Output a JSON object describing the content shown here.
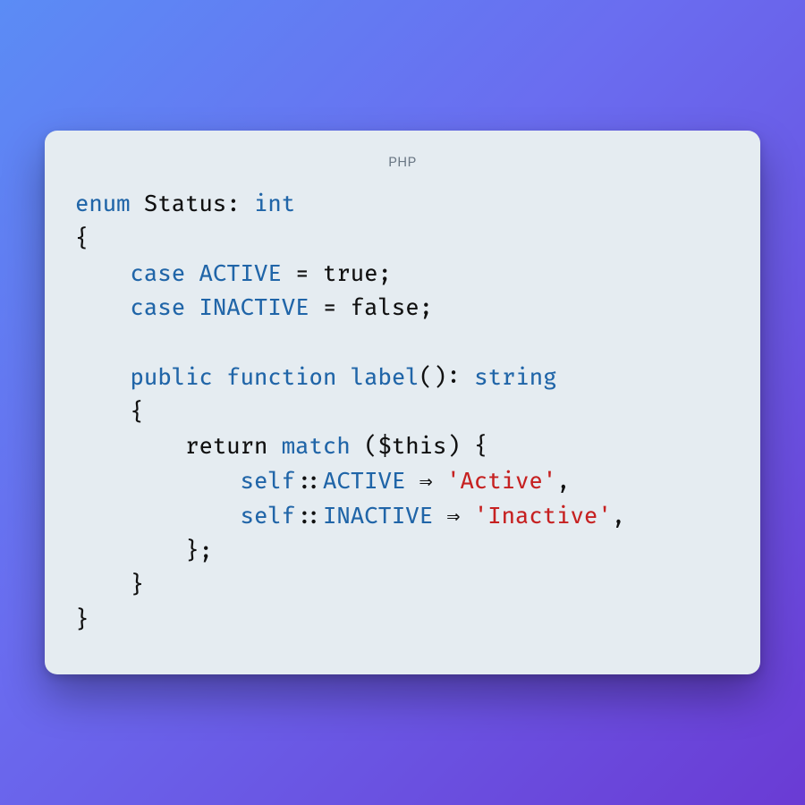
{
  "header": {
    "language": "PHP"
  },
  "code": {
    "tokens": [
      [
        [
          "kw",
          "enum"
        ],
        [
          "def",
          " Status"
        ],
        [
          "def",
          ": "
        ],
        [
          "kw",
          "int"
        ]
      ],
      [
        [
          "def",
          "{"
        ]
      ],
      [
        [
          "def",
          "    "
        ],
        [
          "kw",
          "case"
        ],
        [
          "def",
          " "
        ],
        [
          "kw",
          "ACTIVE"
        ],
        [
          "def",
          " = true;"
        ]
      ],
      [
        [
          "def",
          "    "
        ],
        [
          "kw",
          "case"
        ],
        [
          "def",
          " "
        ],
        [
          "kw",
          "INACTIVE"
        ],
        [
          "def",
          " = false;"
        ]
      ],
      [
        [
          "def",
          ""
        ]
      ],
      [
        [
          "def",
          "    "
        ],
        [
          "kw",
          "public"
        ],
        [
          "def",
          " "
        ],
        [
          "kw",
          "function"
        ],
        [
          "def",
          " "
        ],
        [
          "kw",
          "label"
        ],
        [
          "def",
          "(): "
        ],
        [
          "kw",
          "string"
        ]
      ],
      [
        [
          "def",
          "    {"
        ]
      ],
      [
        [
          "def",
          "        return "
        ],
        [
          "kw",
          "match"
        ],
        [
          "def",
          " ($this) {"
        ]
      ],
      [
        [
          "def",
          "            "
        ],
        [
          "kw",
          "self"
        ],
        [
          "def",
          "::"
        ],
        [
          "kw",
          "ACTIVE"
        ],
        [
          "def",
          " ⇒ "
        ],
        [
          "str",
          "'Active'"
        ],
        [
          "def",
          ","
        ]
      ],
      [
        [
          "def",
          "            "
        ],
        [
          "kw",
          "self"
        ],
        [
          "def",
          "::"
        ],
        [
          "kw",
          "INACTIVE"
        ],
        [
          "def",
          " ⇒ "
        ],
        [
          "str",
          "'Inactive'"
        ],
        [
          "def",
          ","
        ]
      ],
      [
        [
          "def",
          "        };"
        ]
      ],
      [
        [
          "def",
          "    }"
        ]
      ],
      [
        [
          "def",
          "}"
        ]
      ]
    ]
  }
}
